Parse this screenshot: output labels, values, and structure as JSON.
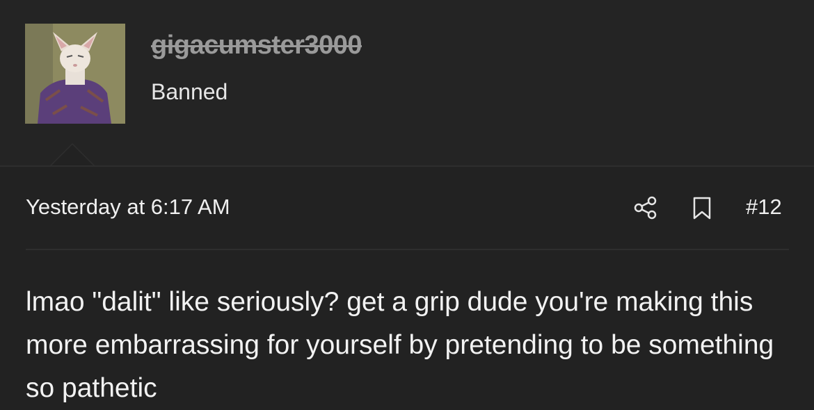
{
  "user": {
    "username": "gigacumster3000",
    "title": "Banned",
    "avatar_icon": "cat-in-sweater-avatar"
  },
  "post": {
    "date": "Yesterday at 6:17 AM",
    "number": "#12",
    "share_icon": "share-icon",
    "bookmark_icon": "bookmark-icon",
    "body": "lmao \"dalit\" like seriously? get a grip dude you're making this more embarrassing for yourself by pretending to be something so pathetic"
  },
  "colors": {
    "background": "#222222",
    "text": "#f2f2f2",
    "username_banned": "#9a9a9a"
  }
}
